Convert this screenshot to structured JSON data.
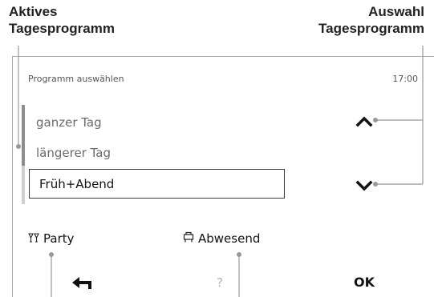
{
  "annotations": {
    "active_program_label": [
      "Aktives",
      "Tagesprogramm"
    ],
    "select_program_label": [
      "Auswahl",
      "Tagesprogramm"
    ]
  },
  "screen": {
    "title": "Programm auswählen",
    "time": "17:00",
    "programs": [
      {
        "label": "ganzer Tag",
        "selected": false
      },
      {
        "label": "längerer Tag",
        "selected": false
      },
      {
        "label": "Früh+Abend",
        "selected": true
      }
    ],
    "buttons": {
      "party": {
        "label": "Party",
        "icon": "party-glasses-icon"
      },
      "away": {
        "label": "Abwesend",
        "icon": "suitcase-icon"
      },
      "back": {
        "icon": "back-arrow-icon"
      },
      "help": {
        "label": "?"
      },
      "ok": {
        "label": "OK"
      }
    },
    "arrow_icons": {
      "up": "chevron-up-icon",
      "down": "chevron-down-icon"
    }
  },
  "colors": {
    "text": "#111111",
    "muted_text": "#6a6a6a",
    "callout_line": "#999999",
    "frame": "#a8a8a8"
  }
}
